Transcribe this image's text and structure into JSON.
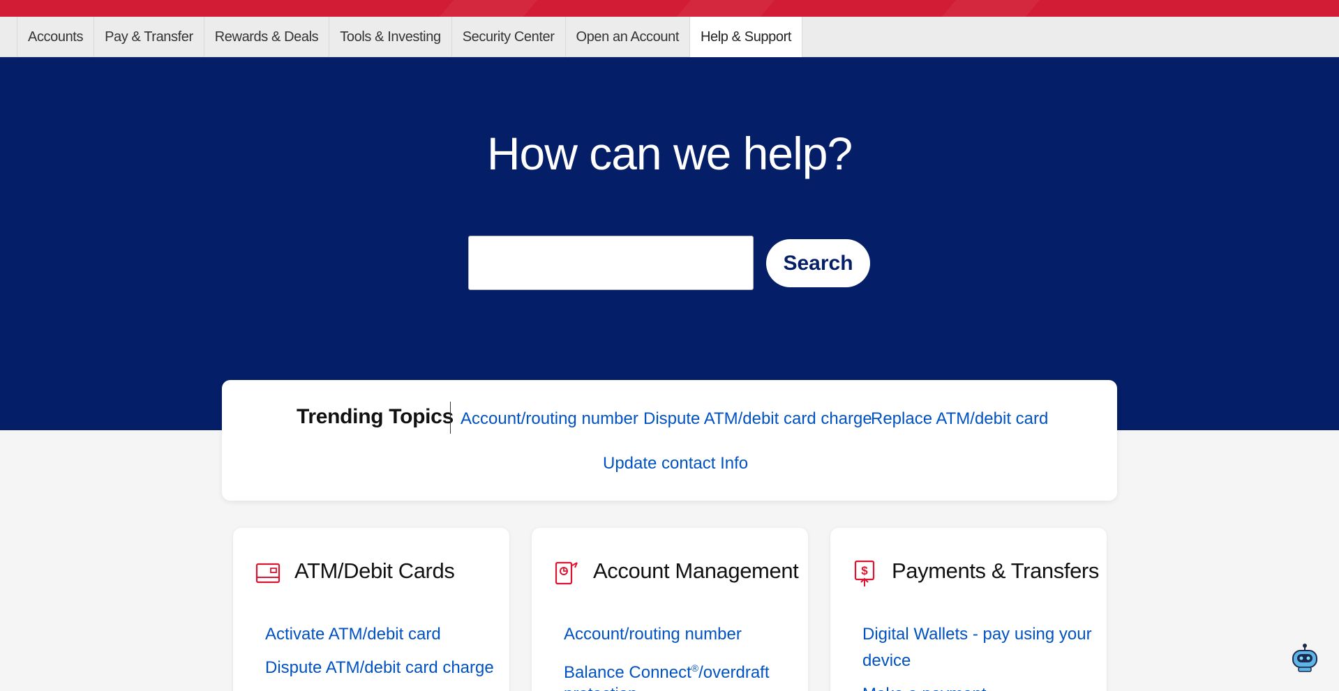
{
  "nav": {
    "tabs": [
      {
        "label": "Accounts"
      },
      {
        "label": "Pay & Transfer"
      },
      {
        "label": "Rewards & Deals"
      },
      {
        "label": "Tools & Investing"
      },
      {
        "label": "Security Center"
      },
      {
        "label": "Open an Account"
      },
      {
        "label": "Help & Support",
        "active": true
      }
    ]
  },
  "hero": {
    "title": "How can we help?",
    "search": {
      "value": "",
      "placeholder": "",
      "button_label": "Search"
    }
  },
  "trending": {
    "title": "Trending Topics",
    "links": [
      "Account/routing number",
      "Dispute ATM/debit card charge",
      "Replace ATM/debit card",
      "Update contact Info"
    ]
  },
  "cards": [
    {
      "title": "ATM/Debit Cards",
      "icon": "debit-card-icon",
      "links": [
        "Activate ATM/debit card",
        "Dispute ATM/debit card charge"
      ]
    },
    {
      "title": "Account Management",
      "icon": "account-management-icon",
      "links": [
        "Account/routing number",
        "Balance Connect",
        "/overdraft",
        "protection"
      ],
      "registered_mark": "®"
    },
    {
      "title": "Payments & Transfers",
      "icon": "payments-transfers-icon",
      "links": [
        "Digital Wallets - pay using your",
        "device",
        "Make a payment"
      ]
    }
  ],
  "colors": {
    "brand_red": "#d21b34",
    "hero_navy": "#041e67",
    "link_blue": "#0052c2",
    "icon_red": "#dc1431"
  },
  "chatbot": {
    "icon": "chatbot-robot-icon"
  }
}
